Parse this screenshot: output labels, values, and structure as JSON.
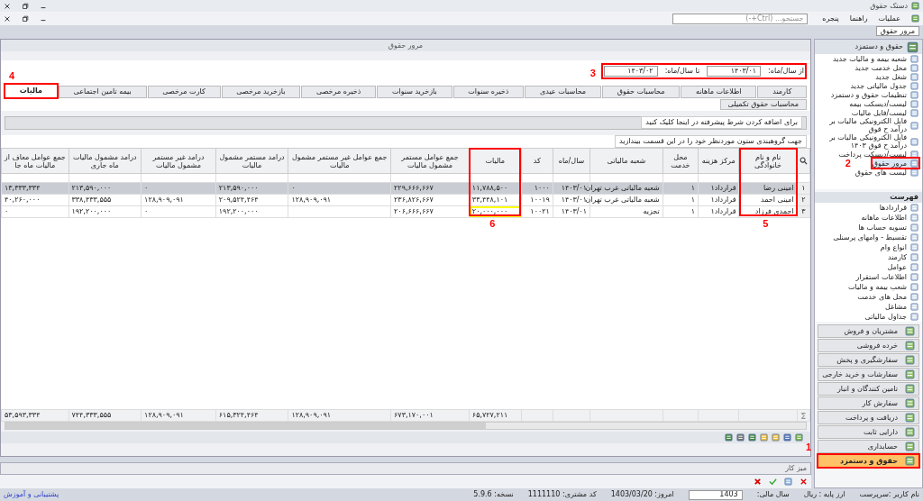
{
  "app_title": "دستک حقوق",
  "menu": [
    "عملیات",
    "راهنما",
    "پنجره"
  ],
  "search": {
    "placeholder": "جستجو... (Ctrl+-)"
  },
  "document_tabs": [
    {
      "label": "مرور حقوق",
      "selected": true
    }
  ],
  "window": {
    "title": "مرور حقوق"
  },
  "filters": [
    {
      "label": "از سال/ماه:",
      "value": "۱۴۰۳/۰۱"
    },
    {
      "label": "تا سال/ماه:",
      "value": "۱۴۰۳/۰۲"
    }
  ],
  "tabs": [
    {
      "label": "کارمند",
      "selected": false
    },
    {
      "label": "اطلاعات ماهانه",
      "selected": false
    },
    {
      "label": "محاسبات حقوق",
      "selected": false
    },
    {
      "label": "محاسبات عیدی",
      "selected": false
    },
    {
      "label": "ذخیره سنوات",
      "selected": false
    },
    {
      "label": "بازخرید سنوات",
      "selected": false
    },
    {
      "label": "ذخیره مرخصی",
      "selected": false
    },
    {
      "label": "بازخرید مرخصی",
      "selected": false
    },
    {
      "label": "کارت مرخصی",
      "selected": false
    },
    {
      "label": "بیمه تامین اجتماعی",
      "selected": false
    },
    {
      "label": "مالیات",
      "selected": true
    }
  ],
  "subtabs": [
    {
      "label": "محاسبات حقوق تکمیلی",
      "selected": false
    }
  ],
  "filter_hint": "برای اضافه کردن شرط پیشرفته در اینجا کلیک کنید",
  "group_hint": "جهت گروهبندی ستون موردنظر خود را در این قسمت بیندازید",
  "table": {
    "columns": [
      "نام و نام خانوادگی",
      "مرکز هزینه",
      "محل خدمت",
      "شعبه مالیاتی",
      "سال/ماه",
      "کد",
      "مالیات",
      "جمع عوامل مستمر مشمول مالیات",
      "جمع عوامل غیر مستمر مشمول مالیات",
      "درامد مستمر مشمول مالیات",
      "درامد غیر مستمر مشمول مالیات",
      "درامد مشمول مالیات ماه جاری",
      "جمع عوامل معاف از مالیات ماه جا"
    ],
    "rows": [
      {
        "index": "۱",
        "selected": true,
        "cells": [
          "امینی رضا",
          "قرارداد۱",
          "۱",
          "شعبه مالیاتی غرب تهران",
          "۱۴۰۳/۰۱",
          "۱۰۰۰",
          "۱۱,۷۸۸,۵۰۰",
          "۲۲۹,۶۶۶,۶۶۷",
          "۰",
          "۲۱۳,۵۹۰,۰۰۰",
          "۰",
          "۲۱۳,۵۹۰,۰۰۰",
          "۱۳,۳۳۳,۳۳۴"
        ]
      },
      {
        "index": "۲",
        "selected": false,
        "cells": [
          "امینی احمد",
          "قرارداد۱",
          "۱",
          "شعبه مالیاتی غرب تهران",
          "۱۴۰۳/۰۱",
          "۱۰۰۱۹",
          "۳۳,۴۴۸,۱۰۱",
          "۲۳۶,۸۲۶,۶۶۷",
          "۱۲۸,۹۰۹,۰۹۱",
          "۲۰۹,۵۲۴,۴۶۴",
          "۱۲۸,۹۰۹,۰۹۱",
          "۳۳۸,۴۳۳,۵۵۵",
          "۴۰,۲۶۰,۰۰۰"
        ]
      },
      {
        "index": "۳",
        "selected": false,
        "cells": [
          "احمدی فرزاد",
          "قرارداد۱",
          "۱",
          "تجزیه",
          "۱۴۰۳/۰۱",
          "۱۰۰۲۱",
          "۲۰,۰۰۰,۰۰۰",
          "۲۰۶,۶۶۶,۶۶۷",
          "",
          "۱۹۲,۲۰۰,۰۰۰",
          "۰",
          "۱۹۲,۲۰۰,۰۰۰",
          "۰"
        ]
      }
    ],
    "totals": [
      "۶۵,۷۲۷,۲۱۱",
      "۶۷۳,۱۷۰,۰۰۱",
      "۱۲۸,۹۰۹,۰۹۱",
      "۶۱۵,۳۲۴,۴۶۴",
      "۱۲۸,۹۰۹,۰۹۱",
      "۷۴۴,۳۳۳,۵۵۵",
      "۵۳,۵۹۳,۳۳۴"
    ]
  },
  "workspace": {
    "title": "میز کار"
  },
  "sidebar": {
    "title": "حقوق و دستمزد",
    "items": [
      {
        "label": "شعبه بیمه و مالیات جدید",
        "selected": false
      },
      {
        "label": "محل خدمت جدید",
        "selected": false
      },
      {
        "label": "شغل جدید",
        "selected": false
      },
      {
        "label": "جدول مالیاتی جدید",
        "selected": false
      },
      {
        "label": "تنظیمات حقوق و دستمزد",
        "selected": false
      },
      {
        "label": "لیست/دیسکت بیمه",
        "selected": false
      },
      {
        "label": "لیست/فایل مالیات",
        "selected": false
      },
      {
        "label": "فایل الکترونیکی مالیات بر درآمد ح قوق",
        "selected": false
      },
      {
        "label": "فایل الکترونیکی مالیات بر درآمد ح قوق ۱۴۰۳",
        "selected": false
      },
      {
        "label": "لیست/دیسکت پرداخت",
        "selected": false
      },
      {
        "label": "مرور حقوق",
        "selected": true
      },
      {
        "label": "لیست های حقوق",
        "selected": false
      }
    ]
  },
  "list_panel": {
    "title": "فهرست",
    "items": [
      "قراردادها",
      "اطلاعات ماهانه",
      "تسویه حساب ها",
      "تقسیط - وامهای پرسنلی",
      "انواع وام",
      "کارمند",
      "عوامل",
      "اطلاعات استقرار",
      "شعب بیمه و مالیات",
      "محل های خدمت",
      "مشاغل",
      "جداول مالیاتی"
    ]
  },
  "modules": [
    {
      "label": "مشتریان و فروش",
      "selected": false
    },
    {
      "label": "خرده فروشی",
      "selected": false
    },
    {
      "label": "سفارشگیری و پخش",
      "selected": false
    },
    {
      "label": "سفارشات و خرید خارجی",
      "selected": false
    },
    {
      "label": "تامین کنندگان و انبار",
      "selected": false
    },
    {
      "label": "سفارش کار",
      "selected": false
    },
    {
      "label": "دریافت و پرداخت",
      "selected": false
    },
    {
      "label": "دارایی ثابت",
      "selected": false
    },
    {
      "label": "حسابداری",
      "selected": false
    },
    {
      "label": "حقوق و دستمزد",
      "selected": true
    }
  ],
  "status_bar": {
    "fields": [
      "نام کاربر :سرپرست",
      "ارز پایه : ریال",
      "سال مالی:",
      "امروز: 1403/03/20",
      "کد مشتری: 1111110",
      "نسخه: 5.9.6"
    ],
    "year": "1403",
    "link": "پشتیبانی و آموزش"
  },
  "annotations": [
    {
      "label": "1",
      "color": "#ff0000"
    },
    {
      "label": "2",
      "color": "#ff0000"
    },
    {
      "label": "3",
      "color": "#ff0000"
    },
    {
      "label": "4",
      "color": "#ff0000"
    },
    {
      "label": "5",
      "color": "#ff0000"
    },
    {
      "label": "6",
      "color": "#ff0000"
    },
    {
      "color": "#ffff00"
    }
  ]
}
